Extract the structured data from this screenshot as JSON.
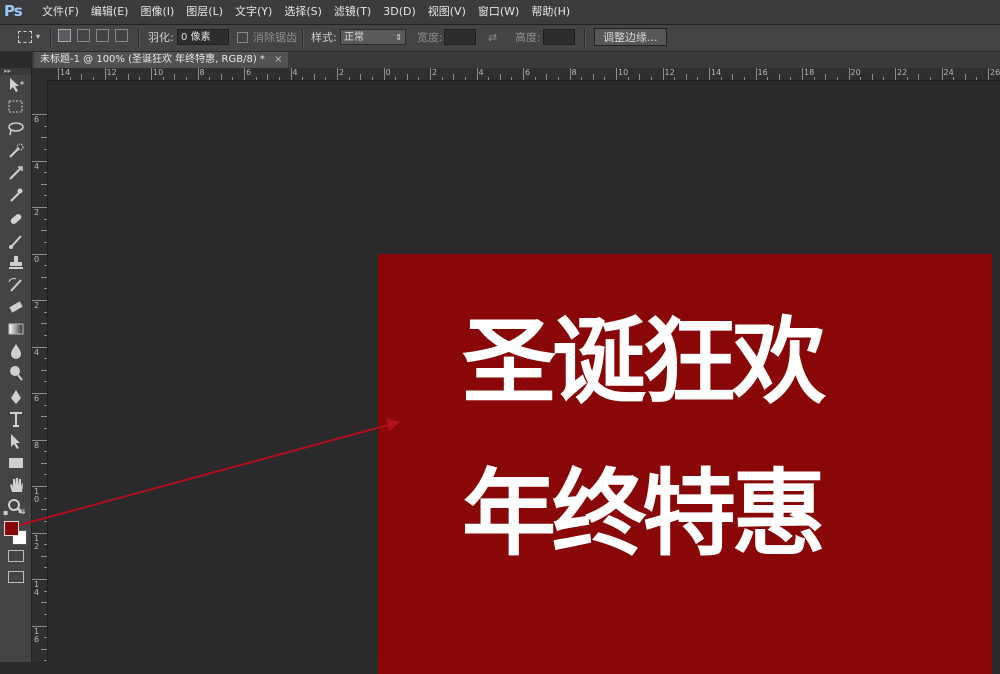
{
  "app": {
    "logo": "Ps"
  },
  "menu": [
    "文件(F)",
    "编辑(E)",
    "图像(I)",
    "图层(L)",
    "文字(Y)",
    "选择(S)",
    "滤镜(T)",
    "3D(D)",
    "视图(V)",
    "窗口(W)",
    "帮助(H)"
  ],
  "options": {
    "feather_label": "羽化:",
    "feather_value": "0 像素",
    "antialias_label": "消除锯齿",
    "style_label": "样式:",
    "style_value": "正常",
    "width_label": "宽度:",
    "height_label": "高度:",
    "refine_edge": "调整边缘..."
  },
  "document_tab": {
    "title": "未标题-1 @ 100% (圣诞狂欢 年终特惠, RGB/8) *",
    "close": "×"
  },
  "ruler_h_labels": [
    "14",
    "12",
    "10",
    "8",
    "6",
    "4",
    "2",
    "0",
    "2",
    "4",
    "6",
    "8",
    "10",
    "12",
    "14",
    "16",
    "18",
    "20",
    "22",
    "24",
    "26"
  ],
  "ruler_v_labels": [
    "6",
    "4",
    "2",
    "0",
    "2",
    "4",
    "6",
    "8",
    "10",
    "12",
    "14",
    "16"
  ],
  "canvas": {
    "line1": "圣诞狂欢",
    "line2": "年终特惠",
    "background_color": "#8a0708",
    "text_color": "#ffffff"
  },
  "swatches": {
    "foreground": "#8a0708",
    "background": "#ffffff"
  },
  "tools": [
    "move-icon",
    "marquee-icon",
    "lasso-icon",
    "quick-select-icon",
    "crop-icon",
    "eyedropper-icon",
    "healing-brush-icon",
    "brush-icon",
    "clone-stamp-icon",
    "history-brush-icon",
    "eraser-icon",
    "gradient-icon",
    "blur-icon",
    "dodge-icon",
    "pen-icon",
    "type-icon",
    "path-select-icon",
    "rectangle-icon",
    "hand-icon",
    "zoom-icon"
  ]
}
